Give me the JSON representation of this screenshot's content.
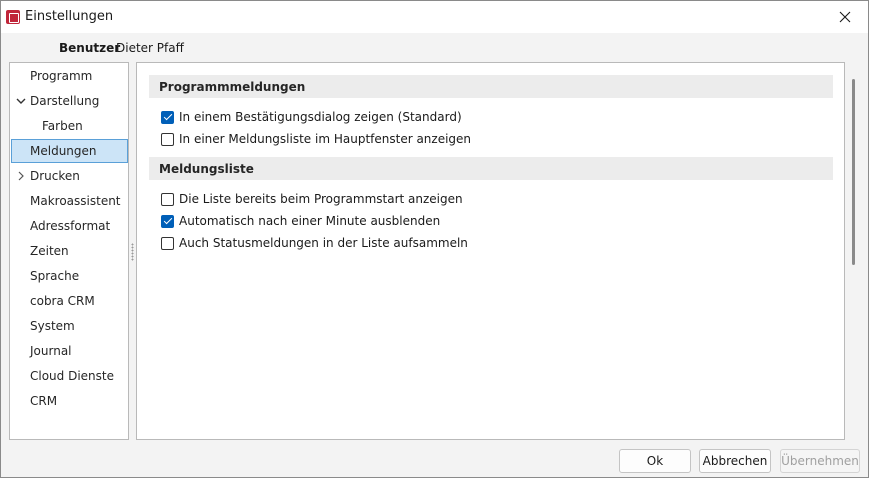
{
  "window": {
    "title": "Einstellungen",
    "icon": "app-icon",
    "close_icon": "close-icon"
  },
  "user": {
    "label": "Benutzer",
    "name": "Dieter Pfaff"
  },
  "nav": {
    "items": [
      {
        "label": "Programm",
        "indent": 0,
        "expander": "none",
        "selected": false
      },
      {
        "label": "Darstellung",
        "indent": 0,
        "expander": "expanded",
        "selected": false
      },
      {
        "label": "Farben",
        "indent": 1,
        "expander": "none",
        "selected": false
      },
      {
        "label": "Meldungen",
        "indent": 0,
        "expander": "none",
        "selected": true
      },
      {
        "label": "Drucken",
        "indent": 0,
        "expander": "collapsed",
        "selected": false
      },
      {
        "label": "Makroassistent",
        "indent": 0,
        "expander": "none",
        "selected": false
      },
      {
        "label": "Adressformat",
        "indent": 0,
        "expander": "none",
        "selected": false
      },
      {
        "label": "Zeiten",
        "indent": 0,
        "expander": "none",
        "selected": false
      },
      {
        "label": "Sprache",
        "indent": 0,
        "expander": "none",
        "selected": false
      },
      {
        "label": "cobra CRM",
        "indent": 0,
        "expander": "none",
        "selected": false
      },
      {
        "label": "System",
        "indent": 0,
        "expander": "none",
        "selected": false
      },
      {
        "label": "Journal",
        "indent": 0,
        "expander": "none",
        "selected": false
      },
      {
        "label": "Cloud Dienste",
        "indent": 0,
        "expander": "none",
        "selected": false
      },
      {
        "label": "CRM",
        "indent": 0,
        "expander": "none",
        "selected": false
      }
    ]
  },
  "sections": [
    {
      "title": "Programmmeldungen",
      "options": [
        {
          "label": "In einem Bestätigungsdialog zeigen (Standard)",
          "checked": true
        },
        {
          "label": "In einer Meldungsliste im Hauptfenster anzeigen",
          "checked": false
        }
      ]
    },
    {
      "title": "Meldungsliste",
      "options": [
        {
          "label": "Die Liste bereits beim Programmstart anzeigen",
          "checked": false
        },
        {
          "label": "Automatisch nach einer Minute ausblenden",
          "checked": true
        },
        {
          "label": "Auch Statusmeldungen in der Liste aufsammeln",
          "checked": false
        }
      ]
    }
  ],
  "buttons": {
    "ok": "Ok",
    "cancel": "Abbrechen",
    "apply": "Übernehmen",
    "apply_enabled": false
  },
  "colors": {
    "accent": "#005fb8",
    "selection_bg": "#cce4f7",
    "selection_border": "#5aa0d8"
  }
}
